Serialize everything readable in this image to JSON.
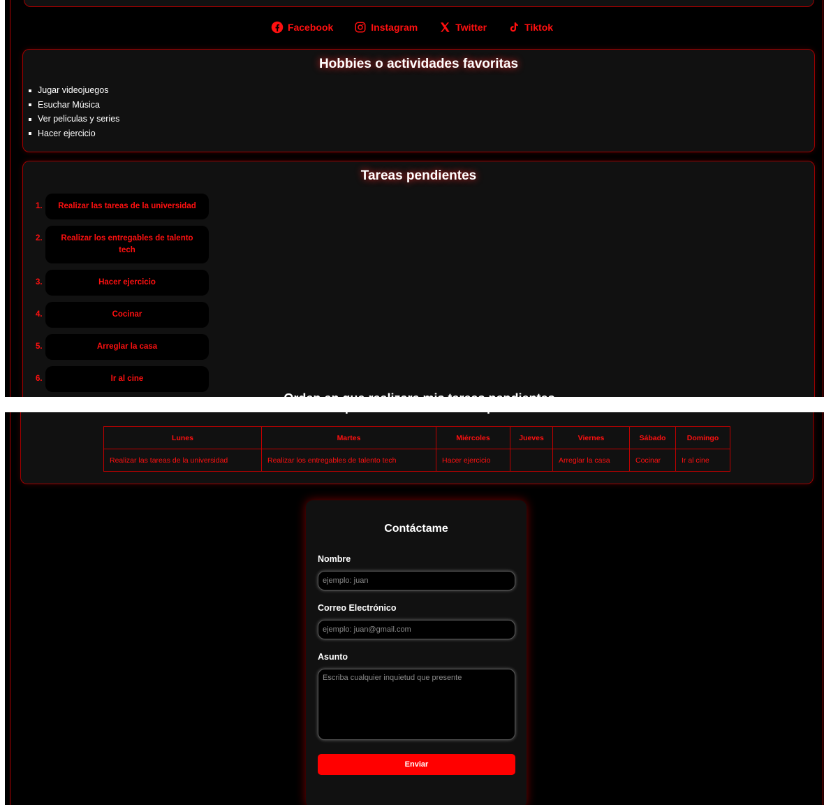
{
  "social": [
    {
      "label": "Facebook",
      "icon": "facebook-icon"
    },
    {
      "label": "Instagram",
      "icon": "instagram-icon"
    },
    {
      "label": "Twitter",
      "icon": "x-twitter-icon"
    },
    {
      "label": "Tiktok",
      "icon": "tiktok-icon"
    }
  ],
  "hobbies": {
    "title": "Hobbies o actividades favoritas",
    "items": [
      "Jugar videojuegos",
      "Esuchar Música",
      "Ver peliculas y series",
      "Hacer ejercicio"
    ]
  },
  "tasks": {
    "title": "Tareas pendientes",
    "items": [
      {
        "num": "1.",
        "label": "Realizar las tareas de la universidad"
      },
      {
        "num": "2.",
        "label": "Realizar los entregables de talento tech"
      },
      {
        "num": "3.",
        "label": "Hacer ejercicio"
      },
      {
        "num": "4.",
        "label": "Cocinar"
      },
      {
        "num": "5.",
        "label": "Arreglar la casa"
      },
      {
        "num": "6.",
        "label": "Ir al cine"
      }
    ],
    "order_title": "Orden en que realizare mis tareas pendientes"
  },
  "schedule": {
    "headers": [
      "Lunes",
      "Martes",
      "Miércoles",
      "Jueves",
      "Viernes",
      "Sábado",
      "Domingo"
    ],
    "row": [
      "Realizar las tareas de la universidad",
      "Realizar los entregables de talento tech",
      "Hacer ejercicio",
      "",
      "Arreglar la casa",
      "Cocinar",
      "Ir al cine"
    ]
  },
  "contact": {
    "title": "Contáctame",
    "name_label": "Nombre",
    "name_placeholder": "ejemplo: juan",
    "email_label": "Correo Electrónico",
    "email_placeholder": "ejemplo: juan@gmail.com",
    "subject_label": "Asunto",
    "subject_placeholder": "Escriba cualquier inquietud que presente",
    "submit_label": "Enviar"
  },
  "colors": {
    "accent": "#ff0000",
    "background": "#000000",
    "card": "#111111",
    "border": "#a00000"
  }
}
